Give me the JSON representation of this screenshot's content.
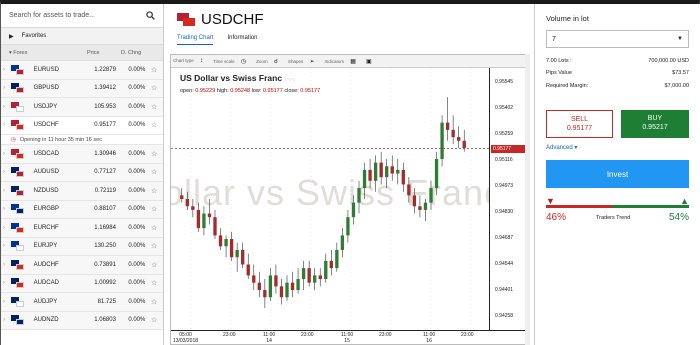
{
  "search": {
    "placeholder": "Search for assets to trade..."
  },
  "favorites": {
    "label": "Favorites"
  },
  "columns": {
    "forex": "Forex",
    "price": "Price",
    "change": "D. Chng"
  },
  "instruments": [
    {
      "symbol": "EURUSD",
      "price": "1.22879",
      "change": "0.00%",
      "f1": "#003399",
      "f2": "#b22234"
    },
    {
      "symbol": "GBPUSD",
      "price": "1.39412",
      "change": "0.00%",
      "f1": "#012169",
      "f2": "#b22234"
    },
    {
      "symbol": "USDJPY",
      "price": "105.953",
      "change": "0.00%",
      "f1": "#b22234",
      "f2": "#ffffff"
    },
    {
      "symbol": "USDCHF",
      "price": "0.95177",
      "change": "0.00%",
      "f1": "#b22234",
      "f2": "#d52b1e"
    },
    {
      "symbol": "USDCAD",
      "price": "1.30946",
      "change": "0.00%",
      "f1": "#b22234",
      "f2": "#d52b1e"
    },
    {
      "symbol": "AUDUSD",
      "price": "0.77127",
      "change": "0.00%",
      "f1": "#012169",
      "f2": "#b22234"
    },
    {
      "symbol": "NZDUSD",
      "price": "0.72119",
      "change": "0.00%",
      "f1": "#012169",
      "f2": "#b22234"
    },
    {
      "symbol": "EURGBP",
      "price": "0.88107",
      "change": "0.00%",
      "f1": "#003399",
      "f2": "#012169"
    },
    {
      "symbol": "EURCHF",
      "price": "1.16984",
      "change": "0.00%",
      "f1": "#003399",
      "f2": "#d52b1e"
    },
    {
      "symbol": "EURJPY",
      "price": "130.250",
      "change": "0.00%",
      "f1": "#003399",
      "f2": "#ffffff"
    },
    {
      "symbol": "AUDCHF",
      "price": "0.73891",
      "change": "0.00%",
      "f1": "#012169",
      "f2": "#d52b1e"
    },
    {
      "symbol": "AUDCAD",
      "price": "1.00992",
      "change": "0.00%",
      "f1": "#012169",
      "f2": "#d52b1e"
    },
    {
      "symbol": "AUDJPY",
      "price": "81.725",
      "change": "0.00%",
      "f1": "#012169",
      "f2": "#ffffff"
    },
    {
      "symbol": "AUDNZD",
      "price": "1.06803",
      "change": "0.00%",
      "f1": "#012169",
      "f2": "#012169"
    }
  ],
  "opening": {
    "text": "Opening in 11 hour 35 min 16 sec"
  },
  "header": {
    "title": "USDCHF"
  },
  "tabs": {
    "chart": "Trading Chart",
    "info": "Information"
  },
  "toolbar": {
    "chart_type": "Chart type",
    "time_scale": "Time scale",
    "zoom": "Zoom",
    "shapes": "Shapes",
    "indicators": "Indicators"
  },
  "chart": {
    "title": "US Dollar vs Swiss Franc",
    "watermark": "ollar vs Swiss Franc",
    "open_label": "open:",
    "open": "0.95229",
    "high_label": "high:",
    "high": "0.95248",
    "low_label": "low:",
    "low": "0.95177",
    "close_label": "close:",
    "close": "0.95177",
    "current_price": "0.95177",
    "y_ticks": [
      "0.95545",
      "0.95402",
      "0.95259",
      "0.95116",
      "0.94973",
      "0.94830",
      "0.94687",
      "0.94544",
      "0.94401",
      "0.94258"
    ],
    "x_ticks": [
      [
        "05:00",
        "13/03/2018"
      ],
      [
        "23:00",
        ""
      ],
      [
        "11:00",
        "14"
      ],
      [
        "23:00",
        ""
      ],
      [
        "11:00",
        "15"
      ],
      [
        "23:00",
        ""
      ],
      [
        "11:00",
        "16"
      ],
      [
        "23:00",
        ""
      ]
    ],
    "up_color": "#2e7d32",
    "down_color": "#a52a2a"
  },
  "chart_data": {
    "type": "candlestick",
    "title": "US Dollar vs Swiss Franc",
    "ylim": [
      0.9418,
      0.9562
    ],
    "candles": [
      [
        0.9492,
        0.9496,
        0.9488,
        0.949
      ],
      [
        0.949,
        0.9494,
        0.9484,
        0.9486
      ],
      [
        0.9486,
        0.949,
        0.948,
        0.9484
      ],
      [
        0.9484,
        0.9488,
        0.9472,
        0.9474
      ],
      [
        0.9474,
        0.9486,
        0.947,
        0.9482
      ],
      [
        0.9482,
        0.949,
        0.9476,
        0.948
      ],
      [
        0.948,
        0.9484,
        0.9468,
        0.947
      ],
      [
        0.947,
        0.9474,
        0.9462,
        0.9464
      ],
      [
        0.9464,
        0.947,
        0.9458,
        0.9468
      ],
      [
        0.9468,
        0.9472,
        0.9456,
        0.9458
      ],
      [
        0.9458,
        0.9466,
        0.945,
        0.9462
      ],
      [
        0.9462,
        0.9466,
        0.9452,
        0.9454
      ],
      [
        0.9454,
        0.946,
        0.9446,
        0.9448
      ],
      [
        0.9448,
        0.9454,
        0.944,
        0.9444
      ],
      [
        0.9444,
        0.945,
        0.9436,
        0.944
      ],
      [
        0.944,
        0.9446,
        0.943,
        0.9436
      ],
      [
        0.9436,
        0.9452,
        0.9434,
        0.9448
      ],
      [
        0.9448,
        0.9454,
        0.9438,
        0.9442
      ],
      [
        0.9442,
        0.9446,
        0.9432,
        0.9436
      ],
      [
        0.9436,
        0.9448,
        0.9434,
        0.9444
      ],
      [
        0.9444,
        0.945,
        0.9436,
        0.944
      ],
      [
        0.944,
        0.9452,
        0.9438,
        0.9446
      ],
      [
        0.9446,
        0.9456,
        0.944,
        0.9452
      ],
      [
        0.9452,
        0.9456,
        0.9442,
        0.9444
      ],
      [
        0.9444,
        0.9452,
        0.944,
        0.9448
      ],
      [
        0.9448,
        0.9452,
        0.9442,
        0.9446
      ],
      [
        0.9446,
        0.946,
        0.9444,
        0.9456
      ],
      [
        0.9456,
        0.9462,
        0.9448,
        0.9452
      ],
      [
        0.9452,
        0.9466,
        0.945,
        0.9462
      ],
      [
        0.9462,
        0.9474,
        0.9458,
        0.947
      ],
      [
        0.947,
        0.9484,
        0.9466,
        0.948
      ],
      [
        0.948,
        0.9492,
        0.9476,
        0.9488
      ],
      [
        0.9488,
        0.95,
        0.9482,
        0.9496
      ],
      [
        0.9496,
        0.951,
        0.949,
        0.9506
      ],
      [
        0.9506,
        0.9512,
        0.9496,
        0.95
      ],
      [
        0.95,
        0.9514,
        0.9494,
        0.951
      ],
      [
        0.951,
        0.9516,
        0.9498,
        0.9502
      ],
      [
        0.9502,
        0.9512,
        0.9496,
        0.9508
      ],
      [
        0.9508,
        0.9514,
        0.95,
        0.9504
      ],
      [
        0.9504,
        0.9512,
        0.9498,
        0.9506
      ],
      [
        0.9506,
        0.951,
        0.9494,
        0.9498
      ],
      [
        0.9498,
        0.9502,
        0.9488,
        0.9492
      ],
      [
        0.9492,
        0.9496,
        0.9482,
        0.9486
      ],
      [
        0.9486,
        0.9492,
        0.948,
        0.9484
      ],
      [
        0.9484,
        0.949,
        0.9478,
        0.9488
      ],
      [
        0.9488,
        0.95,
        0.9484,
        0.9496
      ],
      [
        0.9496,
        0.9516,
        0.9492,
        0.9512
      ],
      [
        0.9512,
        0.9536,
        0.9508,
        0.9532
      ],
      [
        0.9532,
        0.9546,
        0.9522,
        0.9528
      ],
      [
        0.9528,
        0.9536,
        0.952,
        0.9524
      ],
      [
        0.9524,
        0.953,
        0.9518,
        0.9522
      ],
      [
        0.9522,
        0.9528,
        0.9516,
        0.9518
      ]
    ]
  },
  "volume": {
    "label": "Volume in lot",
    "value": "7"
  },
  "details": [
    {
      "k": "7.00 Lots :",
      "v": "700,000.00 USD"
    },
    {
      "k": "Pips Value",
      "v": "$73.57"
    },
    {
      "k": "Required Margin:",
      "v": "$7,000.00"
    }
  ],
  "sell": {
    "label": "SELL",
    "price": "0.95177"
  },
  "buy": {
    "label": "BUY",
    "price": "0.95217"
  },
  "advanced": {
    "label": "Advanced"
  },
  "invest": {
    "label": "Invest"
  },
  "trend": {
    "label": "Traders Trend",
    "bear_pct": "46%",
    "bull_pct": "54%",
    "bear_fraction": 0.46
  }
}
